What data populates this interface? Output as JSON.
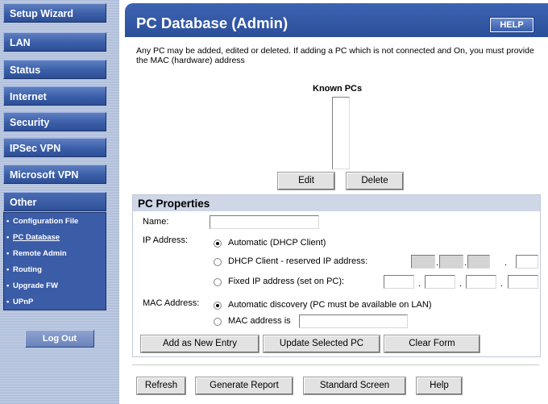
{
  "sidebar": {
    "nav": [
      "Setup Wizard",
      "LAN",
      "Status",
      "Internet",
      "Security",
      "IPSec VPN",
      "Microsoft VPN",
      "Other"
    ],
    "sub_items": [
      "Configuration File",
      "PC Database",
      "Remote Admin",
      "Routing",
      "Upgrade FW",
      "UPnP"
    ],
    "active_sub": "PC Database",
    "logout": "Log Out"
  },
  "header": {
    "title": "PC Database (Admin)",
    "help": "HELP"
  },
  "intro": "Any PC may be added, edited or deleted. If adding a PC which is not connected and On, you must provide the MAC (hardware) address",
  "known_pcs": {
    "label": "Known PCs",
    "edit": "Edit",
    "delete": "Delete"
  },
  "props": {
    "title": "PC Properties",
    "name_label": "Name:",
    "name_value": "",
    "ip_label": "IP Address:",
    "ip_auto": "Automatic (DHCP Client)",
    "ip_reserved": "DHCP Client - reserved IP address:",
    "ip_fixed": "Fixed IP address (set on PC):",
    "ip_selected": "Automatic (DHCP Client)",
    "mac_label": "MAC Address:",
    "mac_auto": "Automatic discovery (PC must be available on LAN)",
    "mac_manual": "MAC address is",
    "mac_selected": "Automatic discovery (PC must be available on LAN)",
    "add": "Add as New Entry",
    "update": "Update Selected PC",
    "clear": "Clear Form"
  },
  "footer": {
    "refresh": "Refresh",
    "report": "Generate Report",
    "standard": "Standard Screen",
    "help": "Help"
  },
  "colors": {
    "sidebar_button": "#3a5ea8",
    "title_bar": "#2b4f9a",
    "panel_header": "#cfd6e6"
  }
}
